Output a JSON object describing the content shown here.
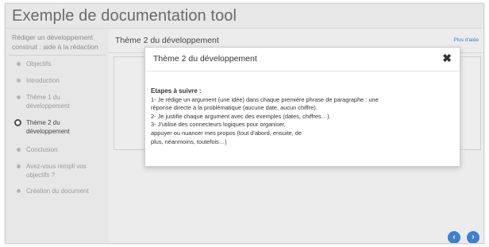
{
  "app": {
    "title": "Exemple de documentation tool"
  },
  "sidebar": {
    "header": "Rédiger un développement construit : aide à la rédaction",
    "items": [
      {
        "label": "Objectifs",
        "current": false
      },
      {
        "label": "Introduction",
        "current": false
      },
      {
        "label": "Thème 1 du développement",
        "current": false
      },
      {
        "label": "Thème 2 du développement",
        "current": true
      },
      {
        "label": "Conclusion",
        "current": false
      },
      {
        "label": "Avez-vous rempli vos objectifs ?",
        "current": false
      },
      {
        "label": "Création du document",
        "current": false
      }
    ]
  },
  "main": {
    "title": "Thème 2 du développement",
    "help_link": "Plus d'aide",
    "nav": {
      "prev_icon": "chevron-left-icon",
      "next_icon": "chevron-right-icon"
    }
  },
  "modal": {
    "title": "Thème 2 du développement",
    "close_icon": "close-icon",
    "heading": "Etapes à suivre :",
    "lines": [
      "1- Je rédige un argument (une idée) dans chaque première phrase de paragraphe : une",
      "réponse directe à la problématique (aucune date, aucun chiffre).",
      "2- Je justifie chaque argument avec des exemples (dates, chiffres…).",
      "3- J'utilise des connecteurs logiques pour organiser,",
      "appuyer ou nuancer mes propos (tout d'abord, ensuite, de",
      "plus, néanmoins, toutefois…)"
    ]
  },
  "colors": {
    "accent": "#3f7fd0",
    "link": "#3f7fbf",
    "background": "#e7e7e7"
  }
}
